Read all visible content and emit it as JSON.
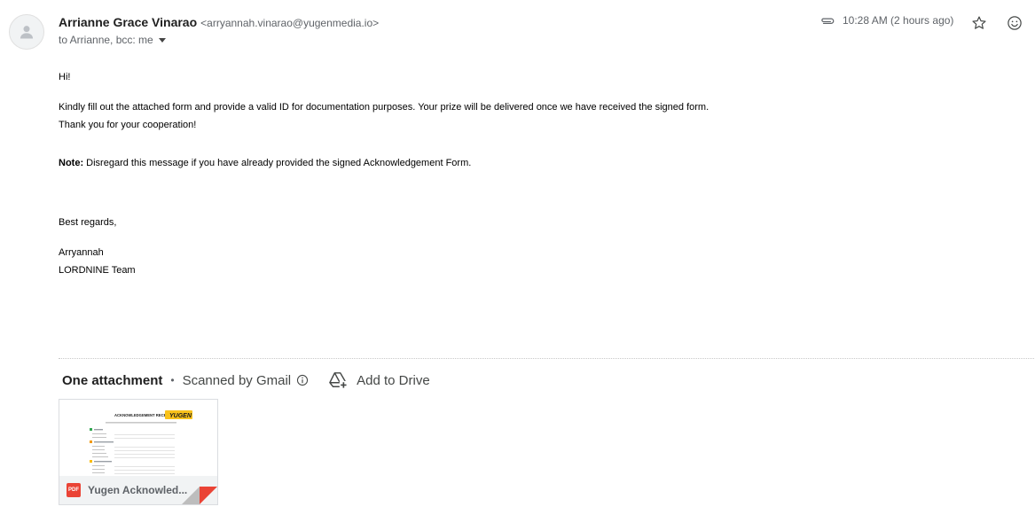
{
  "header": {
    "sender_name": "Arrianne Grace Vinarao",
    "sender_email": "<arryannah.vinarao@yugenmedia.io>",
    "recipients": "to Arrianne, bcc: me",
    "time": "10:28 AM (2 hours ago)",
    "icons": [
      "attachment-clip-icon",
      "star-icon",
      "emoji-reaction-icon"
    ]
  },
  "message": {
    "greeting": "Hi!",
    "line1": "Kindly fill out the attached form and provide a valid ID for documentation purposes. Your prize will be delivered once we have received the signed form.",
    "line2": "Thank you for your cooperation!",
    "note_label": "Note:",
    "note_text": " Disregard this message if you have already provided the signed Acknowledgement Form.",
    "closing": "Best regards,",
    "signature_name": "Arryannah",
    "signature_team": "LORDNINE Team"
  },
  "attachments": {
    "count_label": "One attachment",
    "separator": "•",
    "scanned_label": "Scanned by Gmail",
    "add_to_drive": "Add to Drive",
    "file": {
      "type_badge": "PDF",
      "name": "Yugen Acknowled...",
      "thumbnail": {
        "title": "ACKNOWLEDGEMENT RECEIPT",
        "logo_text": "YUGEN",
        "section_colors": [
          "#34a853",
          "#f29900",
          "#fbbc04"
        ]
      }
    }
  },
  "colors": {
    "pdf_red": "#ea4335",
    "logo_yellow": "#f9c21b",
    "text_secondary": "#5f6368"
  }
}
